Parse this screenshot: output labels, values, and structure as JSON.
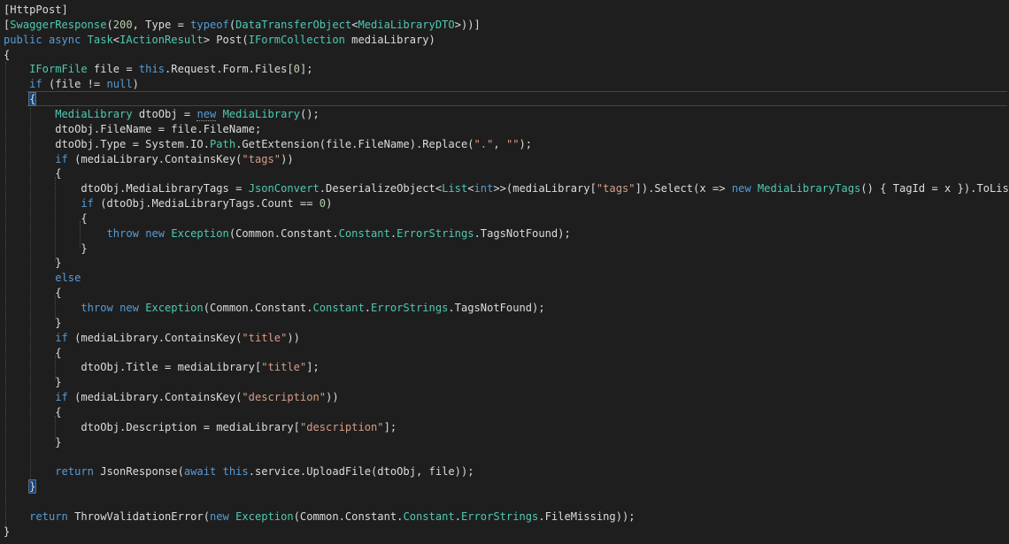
{
  "editor": {
    "language": "C#",
    "theme": "dark",
    "colors": {
      "background": "#1e1e1e",
      "plain": "#dcdcdc",
      "keyword": "#569cd6",
      "type": "#4ec9b0",
      "string": "#d69d85",
      "number": "#b5cea8"
    },
    "lines": [
      [
        [
          "plain",
          "[HttpPost]"
        ]
      ],
      [
        [
          "plain",
          "["
        ],
        [
          "type",
          "SwaggerResponse"
        ],
        [
          "plain",
          "("
        ],
        [
          "num",
          "200"
        ],
        [
          "plain",
          ", Type = "
        ],
        [
          "kw",
          "typeof"
        ],
        [
          "plain",
          "("
        ],
        [
          "type",
          "DataTransferObject"
        ],
        [
          "plain",
          "<"
        ],
        [
          "type",
          "MediaLibraryDTO"
        ],
        [
          "plain",
          ">))]"
        ]
      ],
      [
        [
          "kw",
          "public"
        ],
        [
          "plain",
          " "
        ],
        [
          "kw",
          "async"
        ],
        [
          "plain",
          " "
        ],
        [
          "type",
          "Task"
        ],
        [
          "plain",
          "<"
        ],
        [
          "type",
          "IActionResult"
        ],
        [
          "plain",
          "> Post("
        ],
        [
          "type",
          "IFormCollection"
        ],
        [
          "plain",
          " mediaLibrary)"
        ]
      ],
      [
        [
          "plain",
          "{"
        ]
      ],
      [
        [
          "plain",
          "    "
        ],
        [
          "type",
          "IFormFile"
        ],
        [
          "plain",
          " file = "
        ],
        [
          "kw",
          "this"
        ],
        [
          "plain",
          ".Request.Form.Files["
        ],
        [
          "num",
          "0"
        ],
        [
          "plain",
          "];"
        ]
      ],
      [
        [
          "plain",
          "    "
        ],
        [
          "kw",
          "if"
        ],
        [
          "plain",
          " (file != "
        ],
        [
          "kw",
          "null"
        ],
        [
          "plain",
          ")"
        ]
      ],
      [
        [
          "plain",
          "    "
        ],
        [
          "brace",
          "{"
        ]
      ],
      [
        [
          "plain",
          "        "
        ],
        [
          "type",
          "MediaLibrary"
        ],
        [
          "plain",
          " dtoObj = "
        ],
        [
          "kwsq",
          "new"
        ],
        [
          "plain",
          " "
        ],
        [
          "type",
          "MediaLibrary"
        ],
        [
          "plain",
          "();"
        ]
      ],
      [
        [
          "plain",
          "        dtoObj.FileName = file.FileName;"
        ]
      ],
      [
        [
          "plain",
          "        dtoObj.Type = System.IO."
        ],
        [
          "type",
          "Path"
        ],
        [
          "plain",
          ".GetExtension(file.FileName).Replace("
        ],
        [
          "str",
          "\".\""
        ],
        [
          "plain",
          ", "
        ],
        [
          "str",
          "\"\""
        ],
        [
          "plain",
          ");"
        ]
      ],
      [
        [
          "plain",
          "        "
        ],
        [
          "kw",
          "if"
        ],
        [
          "plain",
          " (mediaLibrary.ContainsKey("
        ],
        [
          "str",
          "\"tags\""
        ],
        [
          "plain",
          "))"
        ]
      ],
      [
        [
          "plain",
          "        {"
        ]
      ],
      [
        [
          "plain",
          "            dtoObj.MediaLibraryTags = "
        ],
        [
          "type",
          "JsonConvert"
        ],
        [
          "plain",
          ".DeserializeObject<"
        ],
        [
          "type",
          "List"
        ],
        [
          "plain",
          "<"
        ],
        [
          "kw",
          "int"
        ],
        [
          "plain",
          ">>(mediaLibrary["
        ],
        [
          "str",
          "\"tags\""
        ],
        [
          "plain",
          "]).Select(x => "
        ],
        [
          "kw",
          "new"
        ],
        [
          "plain",
          " "
        ],
        [
          "type",
          "MediaLibraryTags"
        ],
        [
          "plain",
          "() { TagId = x }).ToList();"
        ]
      ],
      [
        [
          "plain",
          "            "
        ],
        [
          "kw",
          "if"
        ],
        [
          "plain",
          " (dtoObj.MediaLibraryTags.Count == "
        ],
        [
          "num",
          "0"
        ],
        [
          "plain",
          ")"
        ]
      ],
      [
        [
          "plain",
          "            {"
        ]
      ],
      [
        [
          "plain",
          "                "
        ],
        [
          "kw",
          "throw"
        ],
        [
          "plain",
          " "
        ],
        [
          "kw",
          "new"
        ],
        [
          "plain",
          " "
        ],
        [
          "type",
          "Exception"
        ],
        [
          "plain",
          "(Common.Constant."
        ],
        [
          "type",
          "Constant"
        ],
        [
          "plain",
          "."
        ],
        [
          "type",
          "ErrorStrings"
        ],
        [
          "plain",
          ".TagsNotFound);"
        ]
      ],
      [
        [
          "plain",
          "            }"
        ]
      ],
      [
        [
          "plain",
          "        }"
        ]
      ],
      [
        [
          "plain",
          "        "
        ],
        [
          "kw",
          "else"
        ]
      ],
      [
        [
          "plain",
          "        {"
        ]
      ],
      [
        [
          "plain",
          "            "
        ],
        [
          "kw",
          "throw"
        ],
        [
          "plain",
          " "
        ],
        [
          "kw",
          "new"
        ],
        [
          "plain",
          " "
        ],
        [
          "type",
          "Exception"
        ],
        [
          "plain",
          "(Common.Constant."
        ],
        [
          "type",
          "Constant"
        ],
        [
          "plain",
          "."
        ],
        [
          "type",
          "ErrorStrings"
        ],
        [
          "plain",
          ".TagsNotFound);"
        ]
      ],
      [
        [
          "plain",
          "        }"
        ]
      ],
      [
        [
          "plain",
          "        "
        ],
        [
          "kw",
          "if"
        ],
        [
          "plain",
          " (mediaLibrary.ContainsKey("
        ],
        [
          "str",
          "\"title\""
        ],
        [
          "plain",
          "))"
        ]
      ],
      [
        [
          "plain",
          "        {"
        ]
      ],
      [
        [
          "plain",
          "            dtoObj.Title = mediaLibrary["
        ],
        [
          "str",
          "\"title\""
        ],
        [
          "plain",
          "];"
        ]
      ],
      [
        [
          "plain",
          "        }"
        ]
      ],
      [
        [
          "plain",
          "        "
        ],
        [
          "kw",
          "if"
        ],
        [
          "plain",
          " (mediaLibrary.ContainsKey("
        ],
        [
          "str",
          "\"description\""
        ],
        [
          "plain",
          "))"
        ]
      ],
      [
        [
          "plain",
          "        {"
        ]
      ],
      [
        [
          "plain",
          "            dtoObj.Description = mediaLibrary["
        ],
        [
          "str",
          "\"description\""
        ],
        [
          "plain",
          "];"
        ]
      ],
      [
        [
          "plain",
          "        }"
        ]
      ],
      [
        [
          "plain",
          ""
        ]
      ],
      [
        [
          "plain",
          "        "
        ],
        [
          "kw",
          "return"
        ],
        [
          "plain",
          " JsonResponse("
        ],
        [
          "kw",
          "await"
        ],
        [
          "plain",
          " "
        ],
        [
          "kw",
          "this"
        ],
        [
          "plain",
          ".service.UploadFile(dtoObj, file));"
        ]
      ],
      [
        [
          "plain",
          "    "
        ],
        [
          "brace",
          "}"
        ]
      ],
      [
        [
          "plain",
          ""
        ]
      ],
      [
        [
          "plain",
          "    "
        ],
        [
          "kw",
          "return"
        ],
        [
          "plain",
          " ThrowValidationError("
        ],
        [
          "kw",
          "new"
        ],
        [
          "plain",
          " "
        ],
        [
          "type",
          "Exception"
        ],
        [
          "plain",
          "(Common.Constant."
        ],
        [
          "type",
          "Constant"
        ],
        [
          "plain",
          "."
        ],
        [
          "type",
          "ErrorStrings"
        ],
        [
          "plain",
          ".FileMissing));"
        ]
      ],
      [
        [
          "plain",
          "}"
        ]
      ]
    ]
  }
}
